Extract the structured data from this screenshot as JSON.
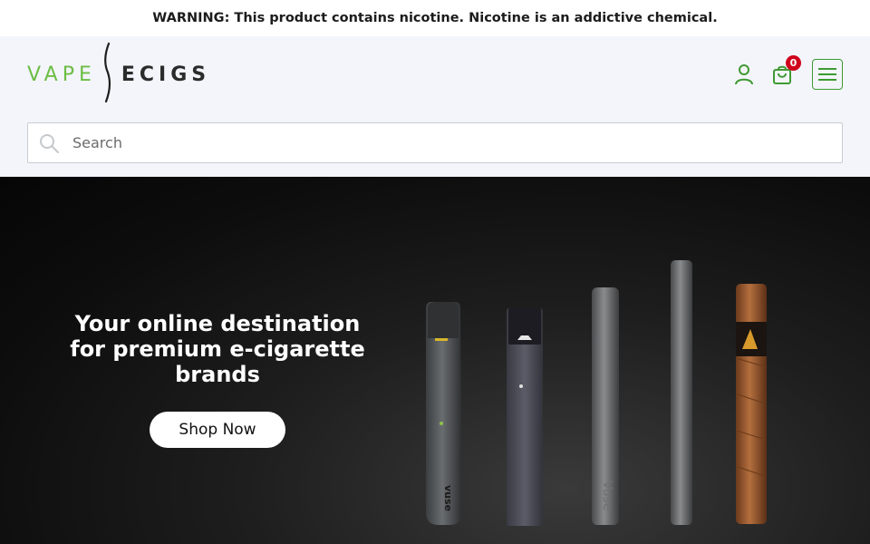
{
  "warning": {
    "text": "WARNING: This product contains nicotine. Nicotine is an addictive chemical."
  },
  "header": {
    "logo": {
      "left_text": "VAPE",
      "right_text": "ECIGS"
    },
    "icons": {
      "account": "user-icon",
      "cart": "shopping-bag-icon",
      "menu": "hamburger-menu-icon"
    },
    "cart_count": "0"
  },
  "search": {
    "placeholder": "Search",
    "value": "",
    "icon": "search-icon"
  },
  "hero": {
    "heading": "Your online destination for premium e-cigarette brands",
    "cta_label": "Shop Now",
    "product_marks": {
      "device_1": "vuse",
      "device_3": "Vuse"
    }
  },
  "colors": {
    "brand_green": "#6cbd45",
    "menu_border": "#3f9a33",
    "badge_red": "#d0021b",
    "hero_bg": "#0d0d0d"
  }
}
